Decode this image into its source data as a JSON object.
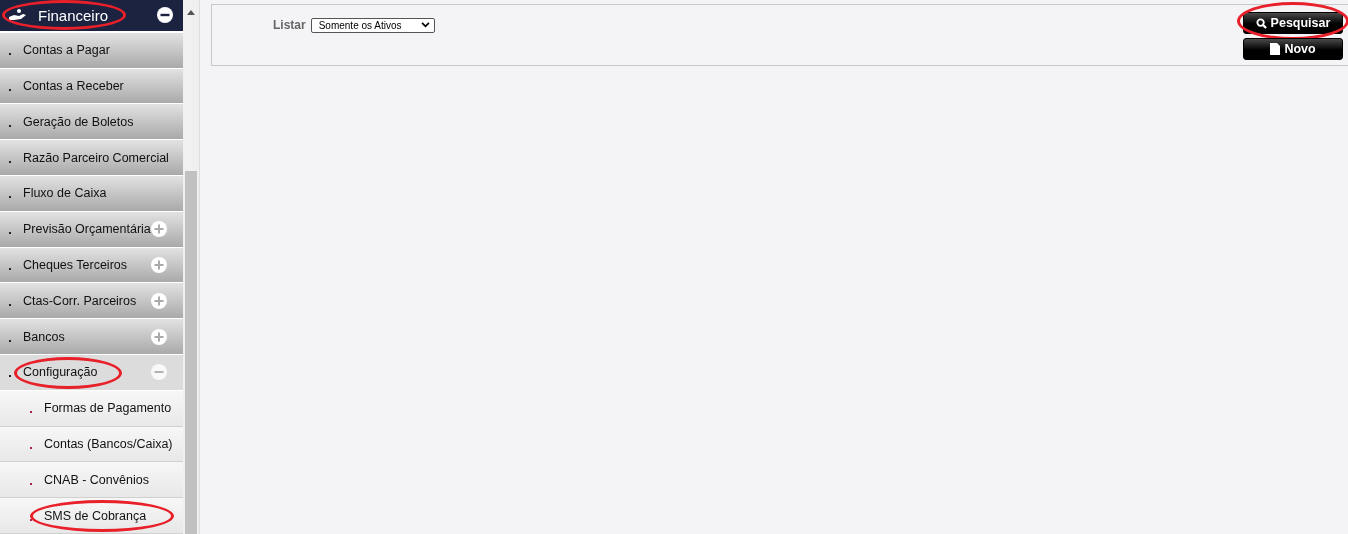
{
  "sidebar": {
    "header": {
      "title": "Financeiro",
      "expanded": true,
      "circled": true
    },
    "items": [
      {
        "label": "Contas a Pagar",
        "kind": "link",
        "circled": false
      },
      {
        "label": "Contas a Receber",
        "kind": "link",
        "circled": false
      },
      {
        "label": "Geração de Boletos",
        "kind": "link",
        "circled": false
      },
      {
        "label": "Razão Parceiro Comercial",
        "kind": "link",
        "circled": false
      },
      {
        "label": "Fluxo de Caixa",
        "kind": "link",
        "circled": false
      },
      {
        "label": "Previsão Orçamentária",
        "kind": "group",
        "expanded": false,
        "circled": false
      },
      {
        "label": "Cheques Terceiros",
        "kind": "group",
        "expanded": false,
        "circled": false
      },
      {
        "label": "Ctas-Corr. Parceiros",
        "kind": "group",
        "expanded": false,
        "circled": false
      },
      {
        "label": "Bancos",
        "kind": "group",
        "expanded": false,
        "circled": false
      },
      {
        "label": "Configuração",
        "kind": "group",
        "expanded": true,
        "circled": true,
        "children": [
          {
            "label": "Formas de Pagamento",
            "circled": false
          },
          {
            "label": "Contas (Bancos/Caixa)",
            "circled": false
          },
          {
            "label": "CNAB - Convênios",
            "circled": false
          },
          {
            "label": "SMS de Cobrança",
            "circled": true
          }
        ]
      }
    ]
  },
  "filter": {
    "label": "Listar",
    "value": "Somente os Ativos"
  },
  "buttons": [
    {
      "label": "Pesquisar",
      "kind": "search",
      "circled": true
    },
    {
      "label": "Novo",
      "kind": "new",
      "circled": false
    }
  ]
}
